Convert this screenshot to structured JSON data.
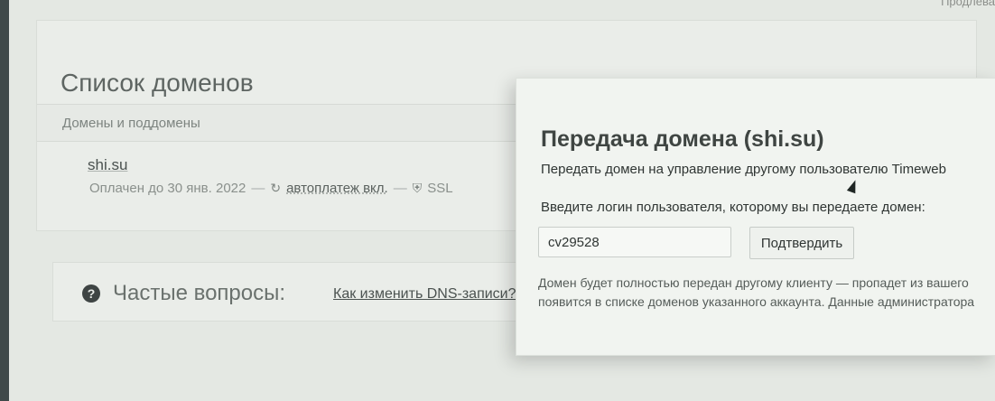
{
  "corner_label": "Продлева",
  "domains": {
    "title": "Список доменов",
    "subheader": "Домены и поддомены",
    "items": [
      {
        "name": "shi.su",
        "paid_until": "Оплачен до 30 янв. 2022",
        "autopay": "автоплатеж вкл.",
        "ssl": "SSL"
      }
    ]
  },
  "faq": {
    "title": "Частые вопросы:",
    "link": "Как изменить DNS-записи?"
  },
  "modal": {
    "title": "Передача домена (shi.su)",
    "description": "Передать домен на управление другому пользователю Timeweb",
    "input_label": "Введите логин пользователя, которому вы передаете домен:",
    "login_value": "cv29528",
    "confirm_label": "Подтвердить",
    "note_line1": "Домен будет полностью передан другому клиенту — пропадет из вашего",
    "note_line2": "появится в списке доменов указанного аккаунта. Данные администратора"
  },
  "icons": {
    "autopay": "refresh-icon",
    "ssl": "shield-icon",
    "faq": "question-circle-icon",
    "cursor": "mouse-pointer-icon"
  }
}
